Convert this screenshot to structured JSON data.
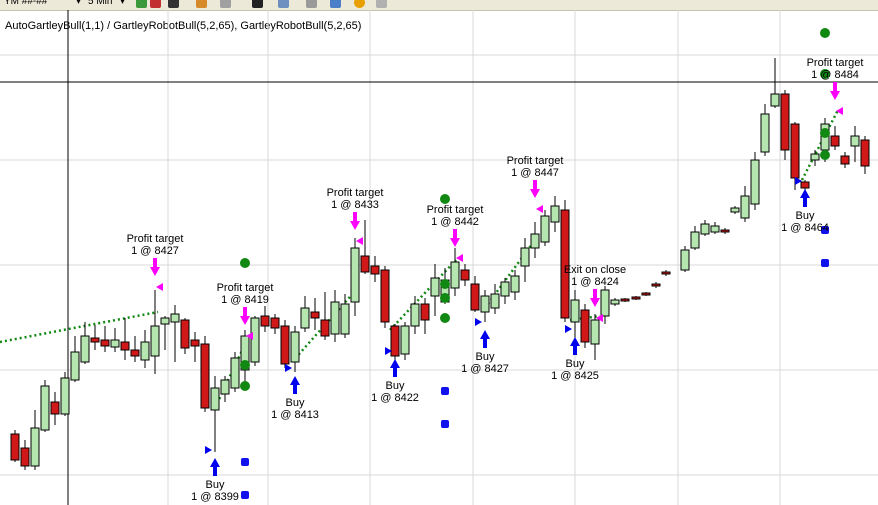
{
  "toolbar": {
    "instrument": "YM ##-##",
    "interval": "5 Min",
    "icons": [
      "bar-type-icon",
      "draw-tool-icon",
      "zoom-in-icon",
      "zoom-out-icon",
      "crosshair-icon",
      "data-box-icon",
      "strategy-icon",
      "chart-trader-icon",
      "alert-icon",
      "properties-icon"
    ]
  },
  "chart": {
    "title": "AutoGartleyBull(1,1) / GartleyRobotBull(5,2,65), GartleyRobotBull(5,2,65)",
    "colors": {
      "up_candle": "#b6e6b0",
      "down_candle": "#d01818",
      "target_arrow": "#ff00ff",
      "buy_arrow": "#0000ee",
      "dot_green": "#118811",
      "dot_blue": "#1111ee",
      "trend_line": "#118811",
      "grid": "#d8d8d8"
    }
  },
  "signals": [
    {
      "kind": "target",
      "line1": "Profit target",
      "line2": "1 @ 8427"
    },
    {
      "kind": "target",
      "line1": "Profit target",
      "line2": "1 @ 8419"
    },
    {
      "kind": "target",
      "line1": "Profit target",
      "line2": "1 @ 8433"
    },
    {
      "kind": "target",
      "line1": "Profit target",
      "line2": "1 @ 8442"
    },
    {
      "kind": "target",
      "line1": "Profit target",
      "line2": "1 @ 8447"
    },
    {
      "kind": "target",
      "line1": "Exit on close",
      "line2": "1 @ 8424"
    },
    {
      "kind": "target",
      "line1": "Profit target",
      "line2": "1 @ 8484"
    },
    {
      "kind": "buy",
      "line1": "Buy",
      "line2": "1 @ 8399"
    },
    {
      "kind": "buy",
      "line1": "Buy",
      "line2": "1 @ 8413"
    },
    {
      "kind": "buy",
      "line1": "Buy",
      "line2": "1 @ 8422"
    },
    {
      "kind": "buy",
      "line1": "Buy",
      "line2": "1 @ 8427"
    },
    {
      "kind": "buy",
      "line1": "Buy",
      "line2": "1 @ 8425"
    },
    {
      "kind": "buy",
      "line1": "Buy",
      "line2": "1 @ 8464"
    }
  ]
}
